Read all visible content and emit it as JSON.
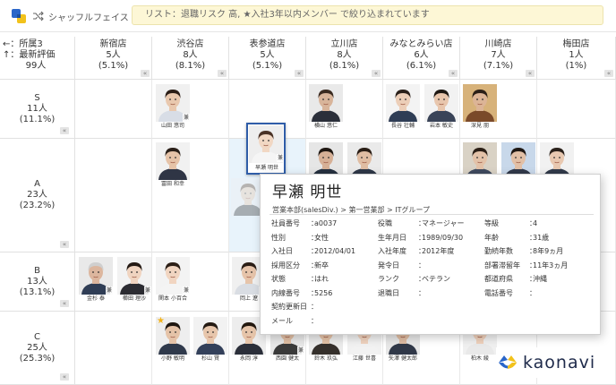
{
  "toolbar": {
    "shuffle_label": "シャッフルフェイス",
    "filter_text": "リスト：退職リスク 高, ★入社3年以内メンバー で絞り込まれています"
  },
  "axis": {
    "x_label": "←：所属3",
    "y_label": "↑：最新評価",
    "total": "99人"
  },
  "columns": [
    {
      "name": "新宿店",
      "count": "5人",
      "pct": "(5.1%)"
    },
    {
      "name": "渋谷店",
      "count": "8人",
      "pct": "(8.1%)"
    },
    {
      "name": "表参道店",
      "count": "5人",
      "pct": "(5.1%)"
    },
    {
      "name": "立川店",
      "count": "8人",
      "pct": "(8.1%)"
    },
    {
      "name": "みなとみらい店",
      "count": "6人",
      "pct": "(6.1%)"
    },
    {
      "name": "川崎店",
      "count": "7人",
      "pct": "(7.1%)"
    },
    {
      "name": "梅田店",
      "count": "1人",
      "pct": "(1%)"
    }
  ],
  "rows": [
    {
      "grade": "S",
      "count": "11人",
      "pct": "(11.1%)"
    },
    {
      "grade": "A",
      "count": "23人",
      "pct": "(23.2%)"
    },
    {
      "grade": "B",
      "count": "13人",
      "pct": "(13.1%)"
    },
    {
      "grade": "C",
      "count": "25人",
      "pct": "(25.3%)"
    }
  ],
  "cards": [
    {
      "name": "山田 悠司",
      "tag": "兼",
      "star": false,
      "skin": "#e9c8ae",
      "hair": "#2b1e17",
      "shirt": "#d8dde6",
      "bg": "#f0f0f0"
    },
    {
      "name": "横山 悠仁",
      "tag": "",
      "star": false,
      "skin": "#d8b49a",
      "hair": "#3a2a20",
      "shirt": "#2b2f3a",
      "bg": "#e9e9e9"
    },
    {
      "name": "長谷 壮輔",
      "tag": "",
      "star": false,
      "skin": "#ecceb8",
      "hair": "#2a201a",
      "shirt": "#2f3d55",
      "bg": "#f3f3f3"
    },
    {
      "name": "岩本 敏史",
      "tag": "",
      "star": false,
      "skin": "#e8c6ad",
      "hair": "#1e1813",
      "shirt": "#3a4458",
      "bg": "#f2f2f2"
    },
    {
      "name": "深見 朋",
      "tag": "",
      "star": false,
      "skin": "#dcb496",
      "hair": "#2b1f17",
      "shirt": "#7a4a2a",
      "bg": "#d7b27a"
    },
    {
      "name": "早瀬 明世",
      "tag": "兼",
      "star": false,
      "skin": "#f1d7c3",
      "hair": "#4a3226",
      "shirt": "#f5f5f5",
      "bg": "#eeeeee"
    },
    {
      "name": "冨田 和幸",
      "tag": "",
      "star": false,
      "skin": "#e6c3a8",
      "hair": "#2a1f18",
      "shirt": "#2f3545",
      "bg": "#f1f1f1"
    },
    {
      "name": "",
      "tag": "",
      "star": false,
      "skin": "#d6b096",
      "hair": "#1f1712",
      "shirt": "#25303f",
      "bg": "#e6e6e6"
    },
    {
      "name": "",
      "tag": "",
      "star": false,
      "skin": "#e0bda3",
      "hair": "#2a1e16",
      "shirt": "#2e3747",
      "bg": "#eaeaea"
    },
    {
      "name": "",
      "tag": "",
      "star": false,
      "skin": "#e3c2a8",
      "hair": "#2b1f16",
      "shirt": "#3f4a5e",
      "bg": "#d9d2c5"
    },
    {
      "name": "",
      "tag": "",
      "star": false,
      "skin": "#e2c0a6",
      "hair": "#1f1813",
      "shirt": "#31394a",
      "bg": "#c8d8ea"
    },
    {
      "name": "",
      "tag": "",
      "star": false,
      "skin": "#e8c8b0",
      "hair": "#2a211b",
      "shirt": "#313a4a",
      "bg": "#f1f1f1"
    },
    {
      "name": "",
      "tag": "",
      "star": false,
      "skin": "#e7c6ab",
      "hair": "#5a3e2a",
      "shirt": "#2e2e2e",
      "bg": "#f0f0f0"
    },
    {
      "name": "金杉 泰",
      "tag": "兼",
      "star": false,
      "skin": "#dcb69e",
      "hair": "#cfcfcf",
      "shirt": "#2f3d55",
      "bg": "#e9e9e9"
    },
    {
      "name": "櫛田 理沙",
      "tag": "兼",
      "star": false,
      "skin": "#f0d4c0",
      "hair": "#241a14",
      "shirt": "#2c2c32",
      "bg": "#f2f2f2"
    },
    {
      "name": "関本 小百合",
      "tag": "兼",
      "star": false,
      "skin": "#f1d5c1",
      "hair": "#2c1f17",
      "shirt": "#f4f4f4",
      "bg": "#f3f3f3"
    },
    {
      "name": "岡上 遼",
      "tag": "兼",
      "star": false,
      "skin": "#e6c4aa",
      "hair": "#2b1e16",
      "shirt": "#d9dde3",
      "bg": "#f0f0f0"
    },
    {
      "name": "小野 敏明",
      "tag": "",
      "star": true,
      "skin": "#e5c3a8",
      "hair": "#1f1711",
      "shirt": "#2f394b",
      "bg": "#eeeeee"
    },
    {
      "name": "杉山 賢",
      "tag": "",
      "star": false,
      "skin": "#e7c6ac",
      "hair": "#241a13",
      "shirt": "#33405a",
      "bg": "#f2f2f2"
    },
    {
      "name": "永岡 淳",
      "tag": "",
      "star": false,
      "skin": "#e6c5aa",
      "hair": "#23190f",
      "shirt": "#2b2f3a",
      "bg": "#ededed"
    },
    {
      "name": "西園 健太",
      "tag": "兼",
      "star": false,
      "skin": "#e0bea4",
      "hair": "#2a1f18",
      "shirt": "#3a3a3a",
      "bg": "#e8e8e8"
    },
    {
      "name": "鈴木 玖弘",
      "tag": "",
      "star": false,
      "skin": "#e4c2a7",
      "hair": "#2c2119",
      "shirt": "#35302c",
      "bg": "#ebebeb"
    },
    {
      "name": "江藤 世喜",
      "tag": "",
      "star": false,
      "skin": "#f0d3bf",
      "hair": "#5c3c28",
      "shirt": "#f2f2f2",
      "bg": "#f1f1f1"
    },
    {
      "name": "矢澤 健太郎",
      "tag": "",
      "star": false,
      "skin": "#dfbda3",
      "hair": "#2a2018",
      "shirt": "#303848",
      "bg": "#e7e7e7"
    },
    {
      "name": "柏木 綾",
      "tag": "",
      "star": false,
      "skin": "#efd1bc",
      "hair": "#3a281d",
      "shirt": "#e9e9e9",
      "bg": "#f0f0f0"
    }
  ],
  "popup": {
    "name": "早瀬 明世",
    "dept": "営業本部(salesDiv.) > 第一営業部 > ITグループ",
    "fields": [
      {
        "k": "社員番号",
        "v": "a0037"
      },
      {
        "k": "性別",
        "v": "女性"
      },
      {
        "k": "入社日",
        "v": "2012/04/01"
      },
      {
        "k": "採用区分",
        "v": "新卒"
      },
      {
        "k": "状態",
        "v": "はれ"
      },
      {
        "k": "内線番号",
        "v": "5256"
      },
      {
        "k": "契約更新日",
        "v": ""
      },
      {
        "k": "メール",
        "v": ""
      },
      {
        "k": "役職",
        "v": "マネージャー"
      },
      {
        "k": "生年月日",
        "v": "1989/09/30"
      },
      {
        "k": "入社年度",
        "v": "2012年度"
      },
      {
        "k": "発令日",
        "v": ""
      },
      {
        "k": "ランク",
        "v": "ベテラン"
      },
      {
        "k": "退職日",
        "v": ""
      },
      {
        "k": "等級",
        "v": "4"
      },
      {
        "k": "年齢",
        "v": "31歳"
      },
      {
        "k": "勤続年数",
        "v": "8年9ヵ月"
      },
      {
        "k": "部署滞留年",
        "v": "11年3ヵ月"
      },
      {
        "k": "都道府県",
        "v": "沖縄"
      },
      {
        "k": "電話番号",
        "v": ""
      }
    ]
  },
  "logo": {
    "word": "kaonavi"
  },
  "colors": {
    "accent_blue": "#2f5da8",
    "logo_blue": "#2a66c9",
    "logo_yellow": "#f2c21b",
    "banner": "#fdf7d6"
  }
}
